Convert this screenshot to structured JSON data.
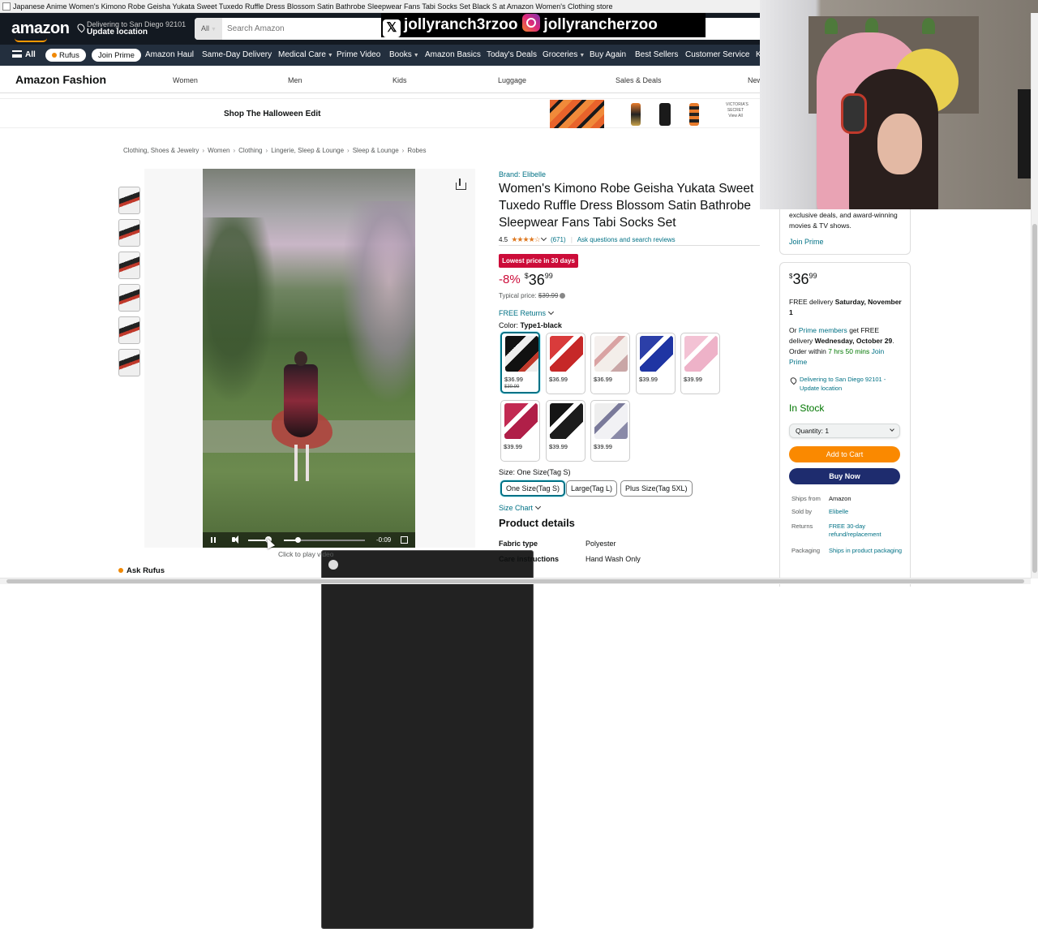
{
  "window": {
    "title": "Japanese Anime Women's Kimono Robe Geisha Yukata Sweet Tuxedo Ruffle Dress Blossom Satin Bathrobe Sleepwear Fans Tabi Socks Set Black S at Amazon Women's Clothing store"
  },
  "header": {
    "logo": "amazon",
    "deliver_line1": "Delivering to San Diego 92101",
    "deliver_line2": "Update location",
    "search_category": "All",
    "search_placeholder": "Search Amazon"
  },
  "overlay": {
    "x_handle": "jollyranch3rzoo",
    "ig_handle": "jollyrancherzoo"
  },
  "nav": {
    "all": "All",
    "rufus": "Rufus",
    "join_prime": "Join Prime",
    "items": [
      "Amazon Haul",
      "Same-Day Delivery",
      "Medical Care",
      "Prime Video",
      "Books",
      "Amazon Basics",
      "Today's Deals",
      "Groceries",
      "Buy Again",
      "Best Sellers",
      "Customer Service",
      "K"
    ]
  },
  "subnav": {
    "brand": "Amazon Fashion",
    "items": [
      "Women",
      "Men",
      "Kids",
      "Luggage",
      "Sales & Deals",
      "New"
    ]
  },
  "promo": {
    "text": "Shop The Halloween Edit",
    "vs_label": "VICTORIA'S SECRET",
    "view_all": "View All"
  },
  "breadcrumb": [
    "Clothing, Shoes & Jewelry",
    "Women",
    "Clothing",
    "Lingerie, Sleep & Lounge",
    "Sleep & Lounge",
    "Robes"
  ],
  "media": {
    "video_time": "-0:09",
    "click_hint": "Click to play video",
    "ask_rufus": "Ask Rufus"
  },
  "product": {
    "brand": "Brand: Elibelle",
    "title": "Women's Kimono Robe Geisha Yukata Sweet Tuxedo Ruffle Dress Blossom Satin Bathrobe Sleepwear Fans Tabi Socks Set",
    "rating": "4.5",
    "review_count": "(671)",
    "ask_link": "Ask questions and search reviews",
    "deal_badge": "Lowest price in 30 days",
    "discount": "-8%",
    "currency": "$",
    "price_whole": "36",
    "price_frac": "99",
    "typical_label": "Typical price:",
    "typical_price": "$39.99",
    "free_returns": "FREE Returns",
    "color_label": "Color:",
    "color_value": "Type1-black",
    "swatches": [
      {
        "price": "$36.99",
        "old": "$39.99"
      },
      {
        "price": "$36.99",
        "old": ""
      },
      {
        "price": "$36.99",
        "old": ""
      },
      {
        "price": "$39.99",
        "old": ""
      },
      {
        "price": "$39.99",
        "old": ""
      },
      {
        "price": "$39.99",
        "old": ""
      },
      {
        "price": "$39.99",
        "old": ""
      },
      {
        "price": "$39.99",
        "old": ""
      }
    ],
    "size_label": "Size:",
    "size_value": "One Size(Tag S)",
    "sizes": [
      "One Size(Tag S)",
      "Large(Tag L)",
      "Plus Size(Tag 5XL)"
    ],
    "size_chart": "Size Chart",
    "details_title": "Product details",
    "details": [
      {
        "k": "Fabric type",
        "v": "Polyester"
      },
      {
        "k": "Care instructions",
        "v": "Hand Wash Only"
      }
    ]
  },
  "prime_rail": {
    "text": "exclusive deals, and award-winning movies & TV shows.",
    "join": "Join Prime"
  },
  "buybox": {
    "currency": "$",
    "price_whole": "36",
    "price_frac": "99",
    "free_delivery": "FREE delivery",
    "free_delivery_date": "Saturday, November 1",
    "or": "Or",
    "prime_members": "Prime members",
    "get_free": "get FREE delivery",
    "fast_date": "Wednesday, October 29",
    "order_within": ". Order within",
    "countdown": "7 hrs 50 mins",
    "join_prime": "Join Prime",
    "deliver_to": "Delivering to San Diego 92101 - Update location",
    "stock": "In Stock",
    "quantity": "Quantity: 1",
    "add_to_cart": "Add to Cart",
    "buy_now": "Buy Now",
    "rows": [
      {
        "k": "Ships from",
        "v": "Amazon",
        "link": false
      },
      {
        "k": "Sold by",
        "v": "Elibelle",
        "link": true
      },
      {
        "k": "Returns",
        "v": "FREE 30-day refund/replacement",
        "link": true
      },
      {
        "k": "Packaging",
        "v": "Ships in product packaging",
        "link": true
      }
    ]
  },
  "colors": {
    "nav_dark": "#131921",
    "nav_main": "#232f3e",
    "link": "#007185",
    "deal": "#cc0c39",
    "add_to_cart": "#fa8900",
    "buy_now": "#1e2c6e",
    "in_stock": "#007600"
  }
}
